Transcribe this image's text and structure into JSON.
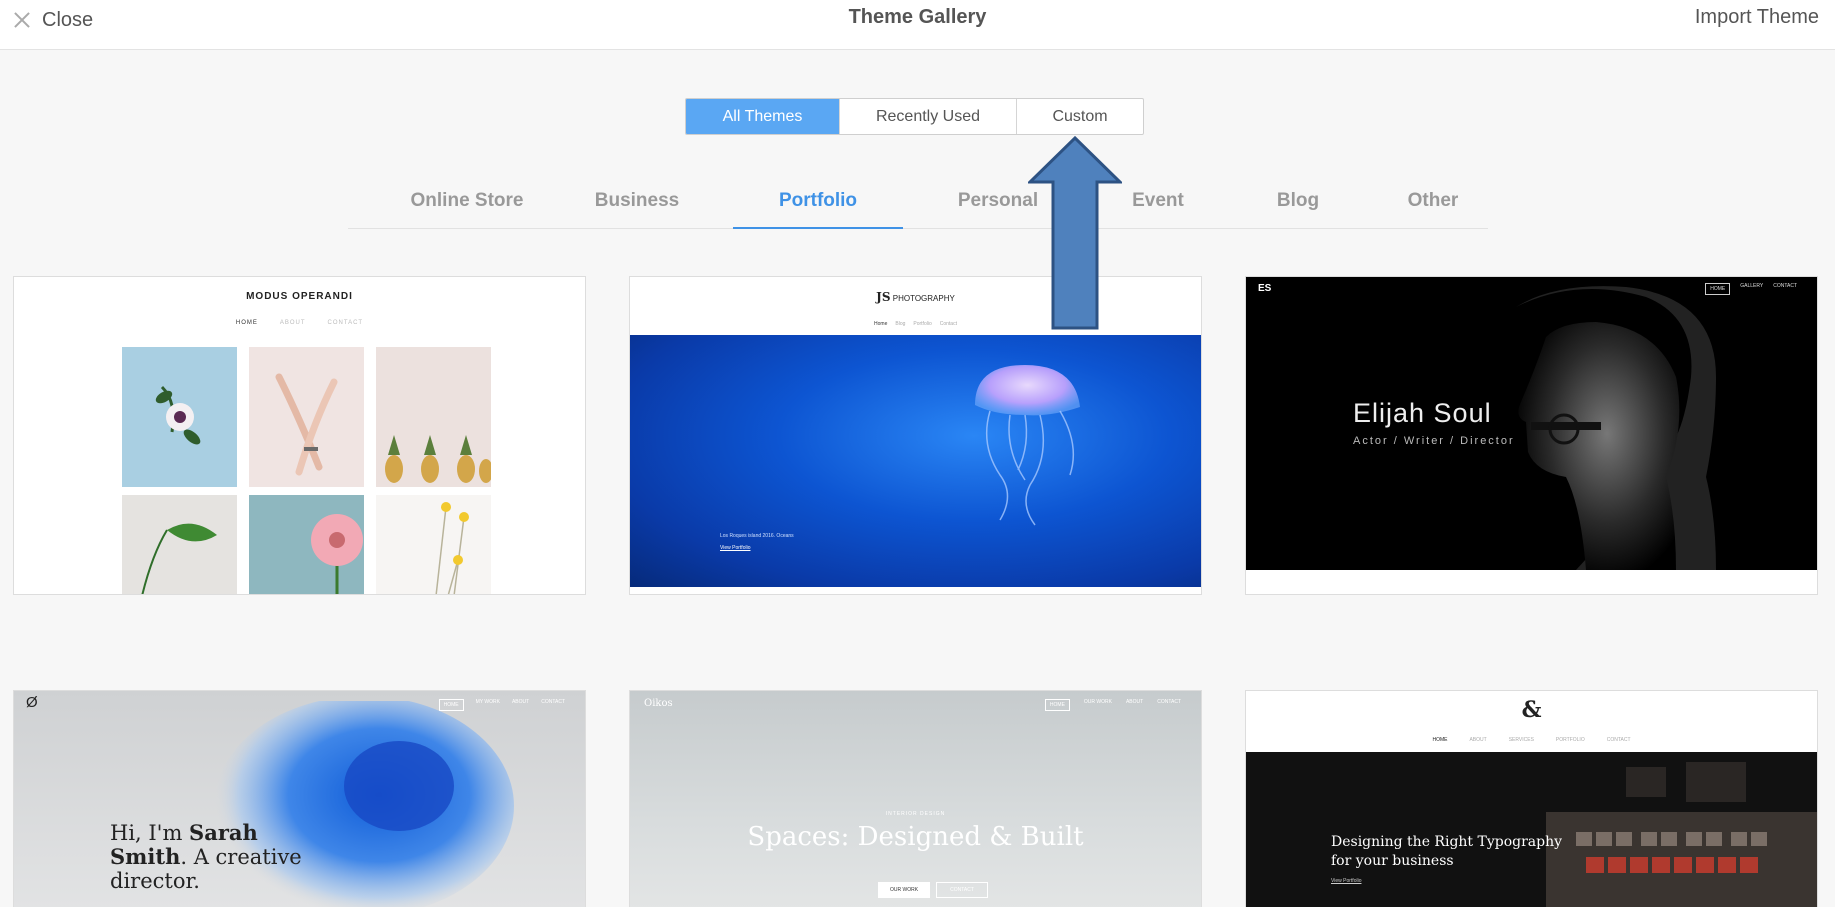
{
  "topbar": {
    "close_label": "Close",
    "title": "Theme Gallery",
    "import_label": "Import Theme"
  },
  "filter_tabs": [
    {
      "label": "All Themes",
      "active": true
    },
    {
      "label": "Recently Used",
      "active": false
    },
    {
      "label": "Custom",
      "active": false
    }
  ],
  "categories": [
    {
      "label": "Online Store",
      "active": false
    },
    {
      "label": "Business",
      "active": false
    },
    {
      "label": "Portfolio",
      "active": true
    },
    {
      "label": "Personal",
      "active": false
    },
    {
      "label": "Event",
      "active": false
    },
    {
      "label": "Blog",
      "active": false
    },
    {
      "label": "Other",
      "active": false
    }
  ],
  "themes": {
    "modus": {
      "brand": "MODUS OPERANDI",
      "nav": [
        "HOME",
        "ABOUT",
        "CONTACT"
      ]
    },
    "js_photo": {
      "brand_mark": "JS",
      "brand_text": "PHOTOGRAPHY",
      "nav": [
        "Home",
        "Blog",
        "Portfolio",
        "Contact"
      ],
      "caption": "Los Roques island 2016. Oceans",
      "link": "View Portfolio"
    },
    "elijah": {
      "initials": "ES",
      "nav": [
        "HOME",
        "GALLERY",
        "CONTACT"
      ],
      "name": "Elijah Soul",
      "subtitle": "Actor / Writer / Director"
    },
    "sarah": {
      "logo": "Ø",
      "nav": [
        "HOME",
        "MY WORK",
        "ABOUT",
        "CONTACT"
      ],
      "line1_pre": "Hi, I'm ",
      "line1_bold": "Sarah",
      "line2_bold": "Smith",
      "line2_rest": ". A creative",
      "line3": "director."
    },
    "spaces": {
      "brand": "Oikos",
      "nav": [
        "HOME",
        "OUR WORK",
        "ABOUT",
        "CONTACT"
      ],
      "kicker": "INTERIOR DESIGN",
      "headline": "Spaces: Designed & Built",
      "button1": "OUR WORK",
      "button2": "CONTACT"
    },
    "typography": {
      "logo": "&",
      "nav": [
        "HOME",
        "ABOUT",
        "SERVICES",
        "PORTFOLIO",
        "CONTACT"
      ],
      "line1": "Designing the Right Typography",
      "line2": "for your business",
      "link": "View Portfolio"
    }
  },
  "colors": {
    "accent": "#3f92e6",
    "segment_active": "#5aa7f3",
    "annotation_arrow": "#4f81bd"
  }
}
